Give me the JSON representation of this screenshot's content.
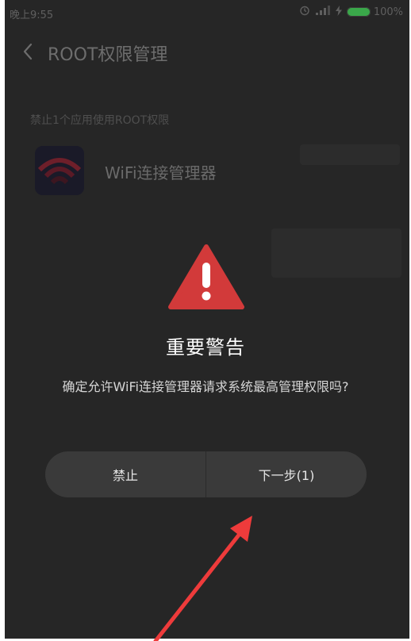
{
  "status_bar": {
    "time": "晚上9:55",
    "battery": "100%",
    "icons": [
      "alarm-icon",
      "signal-icon",
      "charging-icon",
      "battery-icon"
    ]
  },
  "app_bar": {
    "title": "ROOT权限管理",
    "back_icon": "chevron-left-icon"
  },
  "list": {
    "section_label": "禁止1个应用使用ROOT权限",
    "items": [
      {
        "name": "WiFi连接管理器",
        "icon": "wifi-app-icon"
      }
    ]
  },
  "dialog": {
    "icon": "warning-triangle-icon",
    "title": "重要警告",
    "message": "确定允许WiFi连接管理器请求系统最高管理权限吗?",
    "deny_label": "禁止",
    "next_label": "下一步(1)"
  },
  "colors": {
    "background": "#262626",
    "warning": "#d23a3a",
    "button": "#3a3a3a",
    "annotation_arrow": "#ee3b3b",
    "battery": "#3aa84a"
  }
}
